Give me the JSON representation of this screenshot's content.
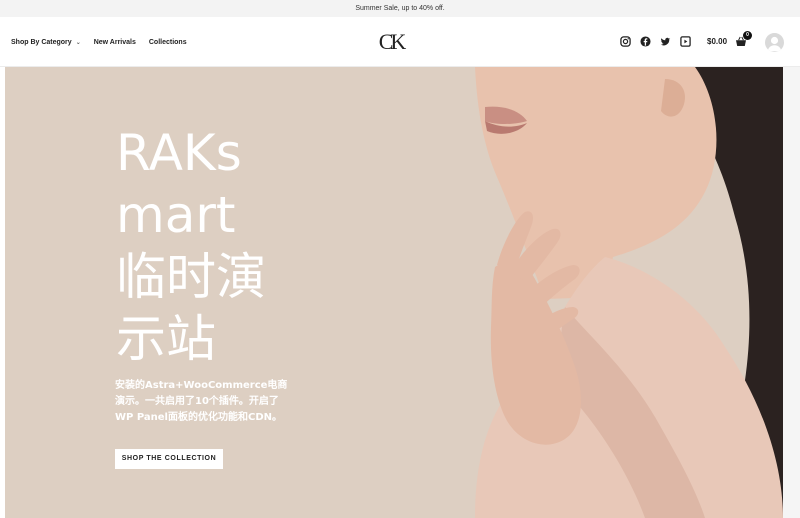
{
  "announcement": "Summer Sale, up to 40% off.",
  "nav": {
    "items": [
      {
        "label": "Shop By Category",
        "has_dropdown": true
      },
      {
        "label": "New Arrivals"
      },
      {
        "label": "Collections"
      }
    ]
  },
  "logo": "CK",
  "socials": [
    "instagram-icon",
    "facebook-icon",
    "twitter-icon",
    "youtube-icon"
  ],
  "cart": {
    "price": "$0.00",
    "count": "0"
  },
  "hero": {
    "title_lines": [
      "RAKs",
      "mart",
      "临时演",
      "示站"
    ],
    "description_lines": [
      "安装的Astra+WooCommerce电商",
      "演示。一共启用了10个插件。开启了",
      "WP Panel面板的优化功能和CDN。"
    ],
    "cta": "SHOP THE COLLECTION"
  },
  "colors": {
    "hero_bg": "#ddcfc2",
    "blouse": "#e8c8b8",
    "skin": "#e8c2ad",
    "hair": "#2b2220"
  }
}
